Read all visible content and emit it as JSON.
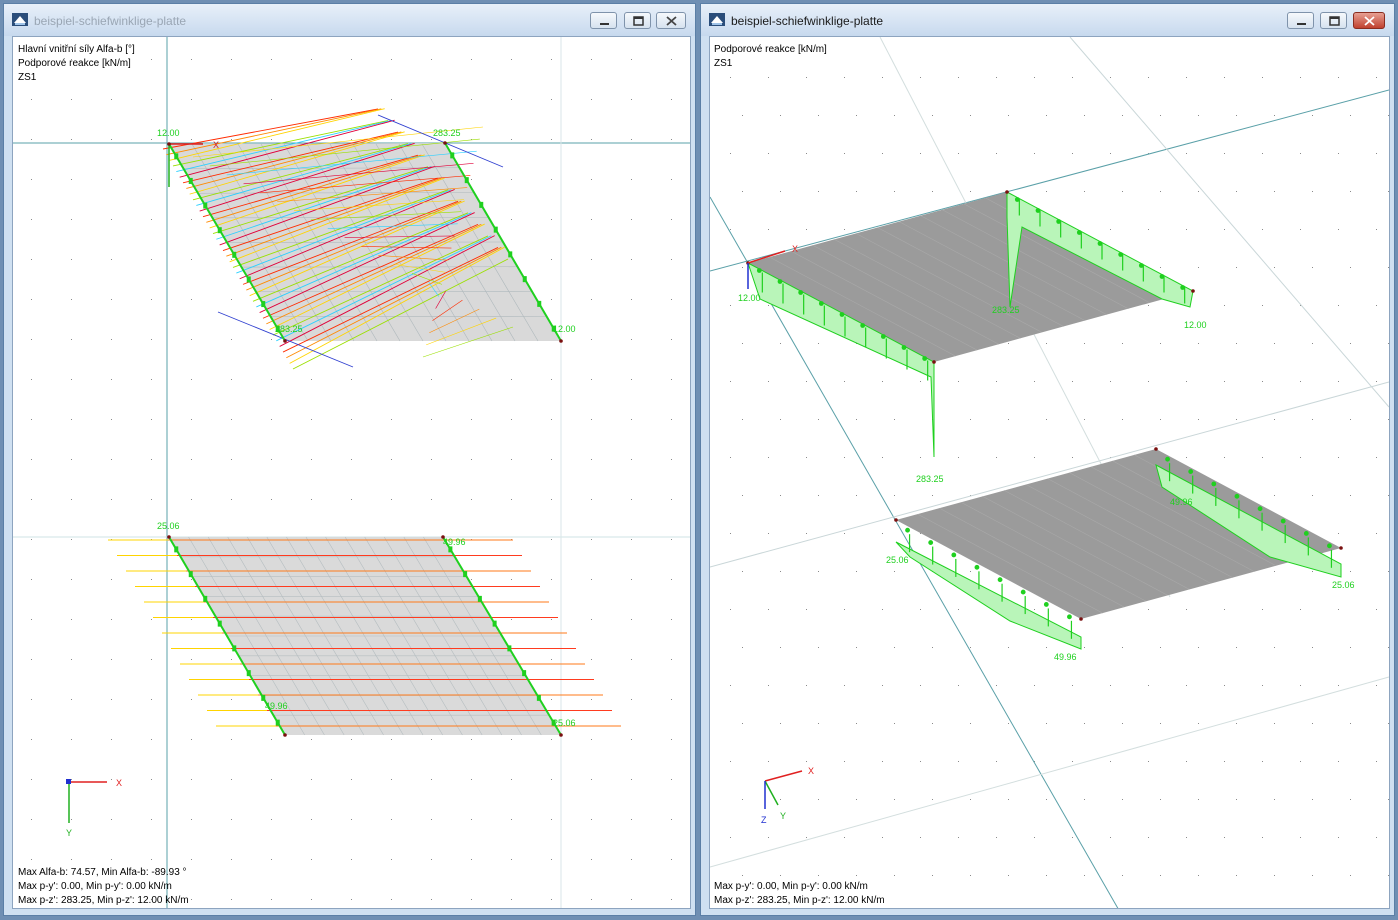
{
  "windows": [
    {
      "title": "beispiel-schiefwinklige-platte",
      "header_lines": [
        "Hlavní vnitřní síly Alfa-b [°]",
        "Podporové reakce [kN/m]",
        "ZS1"
      ],
      "footer_lines": [
        "Max Alfa-b: 74.57, Min Alfa-b: -89.93 °",
        "Max p-y': 0.00, Min p-y': 0.00 kN/m",
        "Max p-z': 283.25, Min p-z': 12.00 kN/m"
      ],
      "value_labels": [
        "12.00",
        "283.25",
        "283.25",
        "12.00",
        "25.06",
        "49.96",
        "49.96",
        "25.06"
      ],
      "axis_labels": {
        "x": "X",
        "y": "Y"
      }
    },
    {
      "title": "beispiel-schiefwinklige-platte",
      "header_lines": [
        "Podporové reakce [kN/m]",
        "ZS1"
      ],
      "footer_lines": [
        "Max p-y': 0.00, Min p-y': 0.00 kN/m",
        "Max p-z': 283.25, Min p-z': 12.00 kN/m"
      ],
      "value_labels": [
        "12.00",
        "283.25",
        "12.00",
        "283.25",
        "49.96",
        "25.06",
        "25.06",
        "49.96"
      ],
      "axis_labels": {
        "x": "X",
        "y": "Y",
        "z": "Z"
      }
    }
  ],
  "colors": {
    "support_green": "#1fd01f",
    "slab_gray": "#9a9a9a",
    "axis_x": "#e02020",
    "axis_y": "#20b020",
    "axis_z": "#2030d0"
  },
  "icons": [
    "app-icon",
    "minimize-icon",
    "restore-icon",
    "close-icon"
  ]
}
